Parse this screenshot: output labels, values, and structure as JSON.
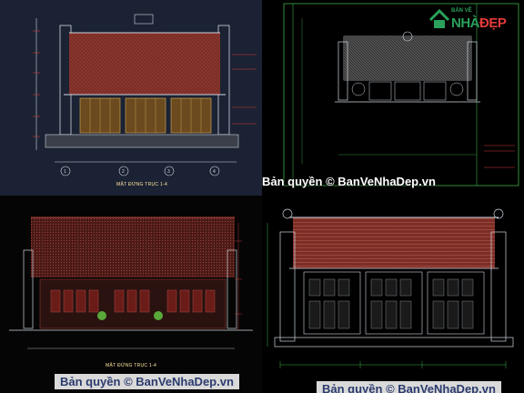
{
  "watermark": {
    "panel2": "Bản quyền © BanVeNhaDep.vn",
    "panel3": "Bản quyền © BanVeNhaDep.vn",
    "panel4": "Bản quyền © BanVeNhaDep.vn"
  },
  "captions": {
    "panel1": "MẶT ĐỨNG TRỤC 1-4",
    "panel3": "MẶT ĐỨNG TRỤC 1-4"
  },
  "axis_labels": [
    "1",
    "2",
    "3",
    "4"
  ],
  "logo": {
    "top": "BẢN VẼ",
    "main_left": "NHÀ",
    "main_right": "ĐẸP"
  },
  "colors": {
    "roof": "#7a2c26",
    "cad_line": "#cfd6e0",
    "dim_red": "#d43a3a",
    "green_frame": "#3fb04a",
    "brand_green": "#2aa15a",
    "brand_red": "#e53a3a"
  }
}
